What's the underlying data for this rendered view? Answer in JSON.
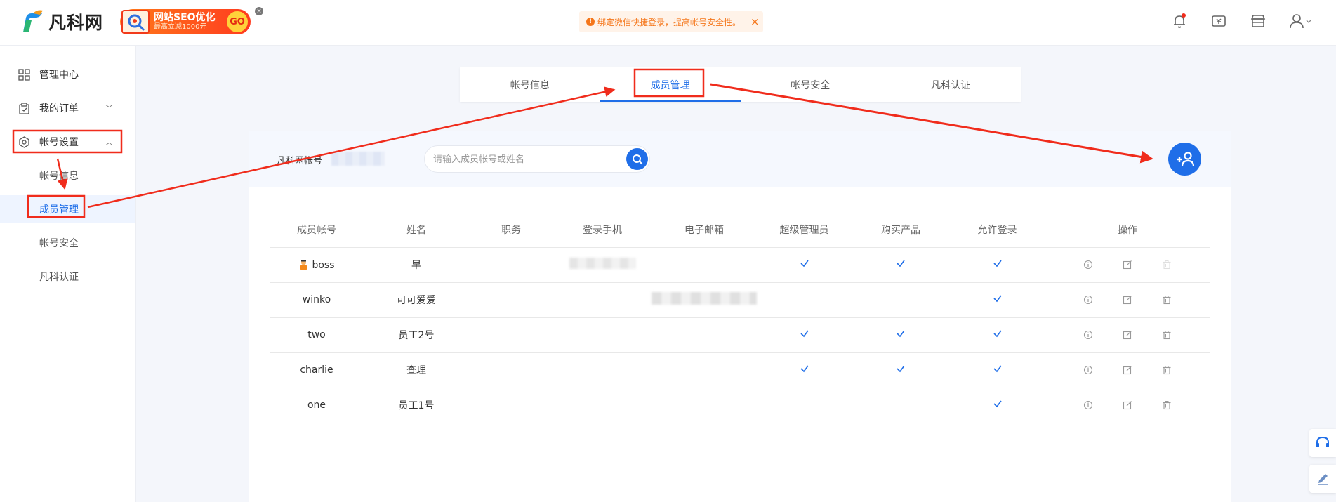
{
  "header": {
    "logo_text": "凡科网",
    "promo_title": "网站SEO优化",
    "promo_sub": "最高立减1000元",
    "promo_go": "GO",
    "promo_close": "×",
    "notice_text": "绑定微信快捷登录，提高帐号安全性。",
    "notice_close": "×",
    "icons": [
      "bell-icon",
      "ticket-icon",
      "store-icon",
      "user-icon"
    ]
  },
  "sidebar": {
    "items": [
      {
        "label": "管理中心",
        "icon": "grid-icon"
      },
      {
        "label": "我的订单",
        "icon": "order-icon"
      },
      {
        "label": "帐号设置",
        "icon": "gear-icon"
      }
    ],
    "subitems": [
      {
        "label": "帐号信息"
      },
      {
        "label": "成员管理"
      },
      {
        "label": "帐号安全"
      },
      {
        "label": "凡科认证"
      }
    ]
  },
  "tabs": [
    {
      "label": "帐号信息"
    },
    {
      "label": "成员管理"
    },
    {
      "label": "帐号安全"
    },
    {
      "label": "凡科认证"
    }
  ],
  "main": {
    "account_label": "凡科网帐号",
    "search_placeholder": "请输入成员帐号或姓名",
    "columns": [
      "成员帐号",
      "姓名",
      "职务",
      "登录手机",
      "电子邮箱",
      "超级管理员",
      "购买产品",
      "允许登录",
      "操作"
    ],
    "rows": [
      {
        "account": "boss",
        "name": "早",
        "title": "",
        "super_admin": true,
        "buy_product": true,
        "allow_login": true
      },
      {
        "account": "winko",
        "name": "可可爱爱",
        "title": "",
        "super_admin": false,
        "buy_product": false,
        "allow_login": true
      },
      {
        "account": "two",
        "name": "员工2号",
        "title": "",
        "super_admin": true,
        "buy_product": true,
        "allow_login": true
      },
      {
        "account": "charlie",
        "name": "查理",
        "title": "",
        "super_admin": true,
        "buy_product": true,
        "allow_login": true
      },
      {
        "account": "one",
        "name": "员工1号",
        "title": "",
        "super_admin": false,
        "buy_product": false,
        "allow_login": true
      }
    ]
  },
  "colors": {
    "accent": "#1f6ee8",
    "annotation": "#f02c1c",
    "notice": "#f5761a"
  }
}
